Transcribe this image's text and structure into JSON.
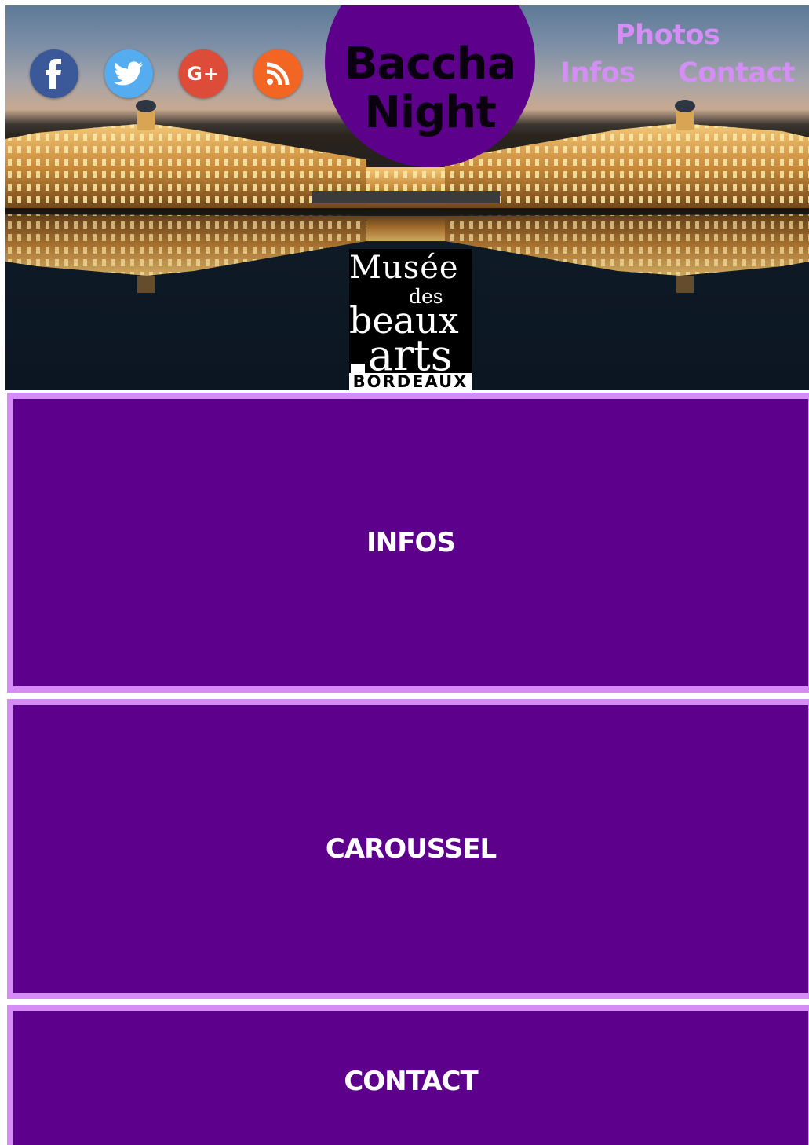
{
  "brand": {
    "line1": "Baccha",
    "line2": "Night",
    "color": "#5d008c"
  },
  "social": [
    {
      "name": "facebook-icon",
      "glyph": "f",
      "color": "#3b5998"
    },
    {
      "name": "twitter-icon",
      "glyph": "bird",
      "color": "#55acee"
    },
    {
      "name": "google-plus-icon",
      "glyph": "G+",
      "color": "#dd4b39"
    },
    {
      "name": "rss-icon",
      "glyph": "rss",
      "color": "#f26522"
    }
  ],
  "nav": {
    "photos": "Photos",
    "infos": "Infos",
    "contact": "Contact",
    "color": "#d48ef5"
  },
  "museum_logo": {
    "musee": "Musée",
    "des": "des",
    "beaux": "beaux",
    "arts": "arts",
    "city": "BORDEAUX"
  },
  "sections": {
    "infos": "INFOS",
    "carousel": "CAROUSSEL",
    "contact": "CONTACT",
    "fill": "#5d008c",
    "border": "#d58cf6"
  }
}
